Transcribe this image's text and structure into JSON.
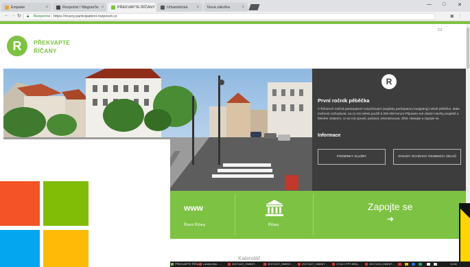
{
  "browser": {
    "tabs": [
      {
        "label": "Empatie",
        "color": "#e8a33d"
      },
      {
        "label": "Rozpočet / Wagnerův",
        "color": "#444444"
      },
      {
        "label": "PŘEKVAPTE ŘÍČANY",
        "color": "#7dc242"
      },
      {
        "label": "Urbanistická",
        "color": "#555555"
      },
      {
        "label": "Nová záložka",
        "color": "#888888"
      }
    ],
    "url_security": "Bezpečné",
    "url": "https://ricany.participativni-rozpocet.cz",
    "window_controls": {
      "minimize": "—",
      "maximize": "□",
      "close": "✕"
    }
  },
  "header": {
    "logo_letter": "R",
    "logo_line1": "PŘEKVAPTE",
    "logo_line2": "ŘÍČANY",
    "right_label": "CZ"
  },
  "panel": {
    "logo_letter": "R",
    "title": "První ročník pěběčka",
    "text": "V Říčanech začíná participativní rozpočtování (anglicky participatory budgeting) neboli pěběčko. Máte možnost rozhodovat, na co má město použít 5 000 000 korun! Připravte své vlastní návrhy projektů a řekněte ostatním, co se má opravit, postavit, rekonstruovat, zlíbit. Hlasujte a zapojte se.",
    "info_title": "Informace",
    "button1": "PODMÍNKY SLUŽBY",
    "button2": "ZÁSADY OCHRANY OSOBNÍCH ÚDAJŮ"
  },
  "band": {
    "www": "www",
    "www_caption": "Řízení Říčany",
    "building_caption": "Říčany",
    "cta": "Zapojte se",
    "cta_arrow": "➜"
  },
  "calendar_heading": "Kalendář",
  "taskbar": {
    "items": [
      {
        "label": "PŘEKVAPTE ŘÍČA...",
        "color": "#7dc242"
      },
      {
        "label": "Lokální film - ...",
        "color": "#d63a2f"
      },
      {
        "label": "20171120_DMINIT...",
        "color": "#d63a2f"
      },
      {
        "label": "20171027_DMINIT...",
        "color": "#d63a2f"
      },
      {
        "label": "20171027_DMINIT...",
        "color": "#d63a2f"
      },
      {
        "label": "171117-PPT-BRA...",
        "color": "#d63a2f"
      },
      {
        "label": "20171004_DMINIT...",
        "color": "#d63a2f"
      }
    ],
    "clock": "11:58"
  },
  "colors": {
    "brand_green": "#7dc242",
    "panel_dark": "#3d3d3d",
    "windows_red": "#f35325",
    "windows_green": "#81bc06",
    "windows_blue": "#05a6f0",
    "windows_yellow": "#ffba08"
  }
}
